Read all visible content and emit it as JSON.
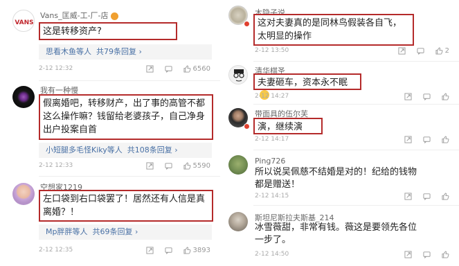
{
  "left": [
    {
      "avatar": "vans-logo",
      "username": "Vans_匡威-工-厂-店",
      "vip": "漂",
      "body": "这是转移资产?",
      "replies": {
        "names": "思看木鱼等人",
        "count": "共79条回复",
        "arrow": "›"
      },
      "date": "2-12 12:32",
      "likes": "6560"
    },
    {
      "avatar": "dark-purple-avatar",
      "username": "我有一种慢",
      "body": "假离婚吧，转移财产，出了事的高管不都这么操作嘛？钱留给老婆孩子，自己净身出户投案自首",
      "replies": {
        "names": "小短腿多毛怪Kiky等人",
        "count": "共108条回复",
        "arrow": "›"
      },
      "date": "2-12 12:33",
      "likes": "5590"
    },
    {
      "avatar": "baby-avatar",
      "username": "空想家1219",
      "body": "左口袋到右口袋罢了！居然还有人信是真离婚？！",
      "replies": {
        "names": "Mp胖胖等人",
        "count": "共69条回复",
        "arrow": "›"
      },
      "date": "2-12 12:35",
      "likes": "3893"
    }
  ],
  "right": [
    {
      "avatar": "sketch-avatar",
      "username": "木隐子说",
      "body": "这对夫妻真的是同林鸟假装各自飞，太明显的操作",
      "date": "2-12 13:50",
      "likes": "2"
    },
    {
      "avatar": "cartoon-glasses-avatar",
      "username": "清华棋圣",
      "body": "夫妻砸车，资本永不眠",
      "date": "2-12 14:27",
      "likes": ""
    },
    {
      "avatar": "woman-avatar",
      "username": "带面具的伍尔芙",
      "body": "演，继续演",
      "date": "2-12 14:17",
      "likes": ""
    },
    {
      "avatar": "green-avatar",
      "username": "Ping726",
      "body": "所以说吴佩慈不结婚是对的！纪给的钱物都是赠送！",
      "date": "2-12 14:15",
      "likes": ""
    },
    {
      "avatar": "gray-avatar",
      "username": "斯坦尼斯拉夫斯基_214",
      "body": "冰雪薇甜，非常有钱。薇这是要领先各位一步了。",
      "date": "2-12 14:50",
      "likes": ""
    }
  ],
  "colors": {
    "highlight": "#b42a2a",
    "link": "#476fa4",
    "meta": "#aaaaaa"
  },
  "icons": {
    "share": "share-icon",
    "comment": "comment-icon",
    "like": "thumbs-up-icon"
  }
}
